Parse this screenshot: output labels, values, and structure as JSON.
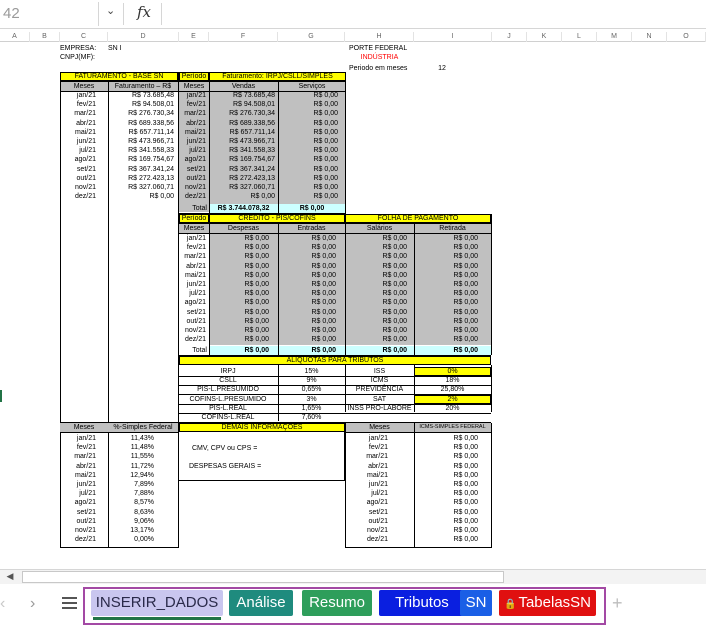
{
  "formula_bar": {
    "name_box": "42",
    "fx": "fx",
    "value": ""
  },
  "columns": [
    "A",
    "B",
    "C",
    "D",
    "E",
    "F",
    "G",
    "H",
    "I",
    "J",
    "K",
    "L",
    "M",
    "N",
    "O"
  ],
  "header": {
    "empresa_label": "EMPRESA:",
    "empresa_value": "SN I",
    "cnpj_label": "CNPJ(MF):",
    "porte": "PORTE FEDERAL",
    "industria": "INDÚSTRIA",
    "periodo_label": "Periodo em meses",
    "periodo_value": "12"
  },
  "faturamento": {
    "title": "FATURAMENTO - BASE SN",
    "periodo": "Período",
    "title2": "Faturamento: IRPJ/CSLL/SIMPLES",
    "h_meses": "Meses",
    "h_fat": "Faturamento – R$",
    "h_meses2": "Meses",
    "h_vendas": "Vendas",
    "h_servicos": "Serviços",
    "months": [
      "jan/21",
      "fev/21",
      "mar/21",
      "abr/21",
      "mai/21",
      "jun/21",
      "jul/21",
      "ago/21",
      "set/21",
      "out/21",
      "nov/21",
      "dez/21"
    ],
    "values": [
      "R$ 73.685,48",
      "R$ 94.508,01",
      "R$ 276.730,34",
      "R$ 689.338,56",
      "R$ 657.711,14",
      "R$ 473.966,71",
      "R$ 341.558,33",
      "R$ 169.754,67",
      "R$ 367.341,24",
      "R$ 272.423,13",
      "R$ 327.060,71",
      "R$ 0,00"
    ],
    "vendas": [
      "R$ 73.685,48",
      "R$ 94.508,01",
      "R$ 276.730,34",
      "R$ 689.338,56",
      "R$ 657.711,14",
      "R$ 473.966,71",
      "R$ 341.558,33",
      "R$ 169.754,67",
      "R$ 367.341,24",
      "R$ 272.423,13",
      "R$ 327.060,71",
      "R$ 0,00"
    ],
    "servicos": [
      "R$ 0,00",
      "R$ 0,00",
      "R$ 0,00",
      "R$ 0,00",
      "R$ 0,00",
      "R$ 0,00",
      "R$ 0,00",
      "R$ 0,00",
      "R$ 0,00",
      "R$ 0,00",
      "R$ 0,00",
      "R$ 0,00"
    ],
    "total_label": "Total",
    "total_vendas": "R$ 3.744.078,32",
    "total_servicos": "R$ 0,00"
  },
  "credito": {
    "periodo": "Período",
    "title": "CRÉDITO - PIS/COFINS",
    "folha": "FOLHA DE PAGAMENTO",
    "h_meses": "Meses",
    "h_despesas": "Despesas",
    "h_entradas": "Entradas",
    "h_salarios": "Salários",
    "h_retirada": "Retirada",
    "months": [
      "jan/21",
      "fev/21",
      "mar/21",
      "abr/21",
      "mai/21",
      "jun/21",
      "jul/21",
      "ago/21",
      "set/21",
      "out/21",
      "nov/21",
      "dez/21"
    ],
    "zero": "R$ 0,00",
    "total_label": "Total",
    "total": "R$ 0,00"
  },
  "aliquotas": {
    "title": "ALIQUOTAS PARA TRIBUTOS",
    "left": [
      {
        "label": "IRPJ",
        "value": "15%"
      },
      {
        "label": "CSLL",
        "value": "9%"
      },
      {
        "label": "PIS-L.PRESUMIDO",
        "value": "0,65%"
      },
      {
        "label": "COFINS-L.PRESUMIDO",
        "value": "3%"
      },
      {
        "label": "PIS-L.REAL",
        "value": "1,65%"
      },
      {
        "label": "COFINS-L.REAL",
        "value": "7,60%"
      }
    ],
    "right": [
      {
        "label": "ISS",
        "value": "0%",
        "hl": true
      },
      {
        "label": "ICMS",
        "value": "18%",
        "hl": false
      },
      {
        "label": "PREVIDÊNCIA",
        "value": "25,80%",
        "hl": false
      },
      {
        "label": "SAT",
        "value": "2%",
        "hl": true
      },
      {
        "label": "INSS PRO-LABORE",
        "value": "20%",
        "hl": false
      }
    ]
  },
  "simples": {
    "h_meses": "Meses",
    "h_pct": "%-Simples Federal",
    "months": [
      "jan/21",
      "fev/21",
      "mar/21",
      "abr/21",
      "mai/21",
      "jun/21",
      "jul/21",
      "ago/21",
      "set/21",
      "out/21",
      "nov/21",
      "dez/21"
    ],
    "values": [
      "11,43%",
      "11,48%",
      "11,55%",
      "11,72%",
      "12,94%",
      "7,89%",
      "7,88%",
      "8,57%",
      "8,63%",
      "9,06%",
      "13,17%",
      "0,00%"
    ]
  },
  "demais": {
    "title": "DEMAIS INFORMAÇÕES",
    "cmv": "CMV, CPV ou CPS =",
    "despesas": "DESPESAS GERAIS ="
  },
  "icms": {
    "h_meses": "Meses",
    "h_title": "ICMS-SIMPLES FEDERAL",
    "months": [
      "jan/21",
      "fev/21",
      "mar/21",
      "abr/21",
      "mai/21",
      "jun/21",
      "jul/21",
      "ago/21",
      "set/21",
      "out/21",
      "nov/21",
      "dez/21"
    ],
    "zero": "R$ 0,00"
  },
  "tabs": [
    {
      "label": "INSERIR_DADOS",
      "bg": "#c9c6ef",
      "fg": "#2a2a4a",
      "active": true
    },
    {
      "label": "Análise",
      "bg": "#1f8b7e",
      "fg": "#ffffff",
      "active": false
    },
    {
      "label": "Resumo",
      "bg": "#2e9e5b",
      "fg": "#ffffff",
      "active": false
    },
    {
      "label": "Tributos",
      "bg": "#0a1fe0",
      "fg": "#ffffff",
      "active": false
    },
    {
      "label": "SN",
      "bg": "#1a5fe6",
      "fg": "#ffffff",
      "active": false
    },
    {
      "label": "TabelasSN",
      "bg": "#e01010",
      "fg": "#ffffff",
      "active": false,
      "locked": true
    }
  ],
  "colors": {
    "tab_frame": "#a349a4",
    "industria": "#ff0000",
    "highlight": "#ffff00",
    "gray": "#c0c0c0",
    "cyan": "#ccffff"
  }
}
